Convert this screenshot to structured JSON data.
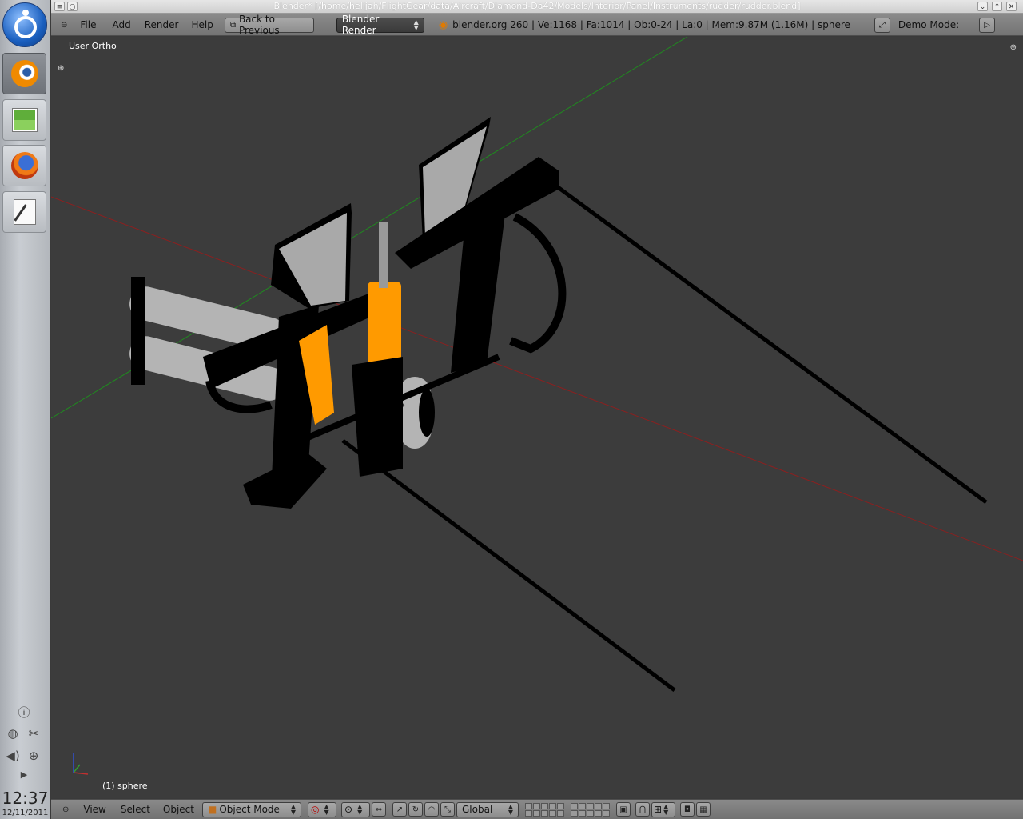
{
  "window": {
    "title": "Blender* [/home/helijah/FlightGear/data/Aircraft/Diamond-Da42/Models/Interior/Panel/Instruments/rudder/rudder.blend]"
  },
  "header": {
    "menus": [
      "File",
      "Add",
      "Render",
      "Help"
    ],
    "back_label": "Back to Previous",
    "engine": "Blender Render",
    "stats": "blender.org 260 | Ve:1168 | Fa:1014 | Ob:0-24 | La:0 | Mem:9.87M (1.16M) | sphere",
    "demo_mode": "Demo Mode:"
  },
  "viewport": {
    "view_name": "User Ortho",
    "object_label": "(1) sphere"
  },
  "footer": {
    "menus": [
      "View",
      "Select",
      "Object"
    ],
    "mode": "Object Mode",
    "orientation": "Global"
  },
  "dock": {
    "time": "12:37",
    "date": "12/11/2011"
  },
  "colors": {
    "viewport_bg": "#3c3c3c",
    "orange": "#ff9a00",
    "grey": "#b4b4b4",
    "axis_x": "#a02020",
    "axis_y": "#1f8a1f"
  }
}
